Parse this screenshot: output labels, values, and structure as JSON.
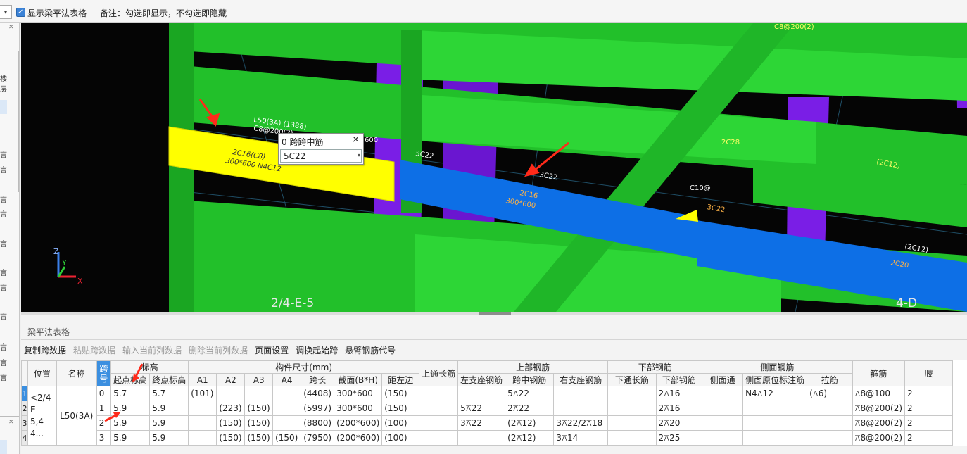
{
  "topbar": {
    "show_table_label": "显示梁平法表格",
    "remark": "备注：勾选即显示，不勾选即隐藏"
  },
  "viewport": {
    "popup": {
      "title": "0 跨跨中筋",
      "close": "×",
      "value": "5C22"
    },
    "axis_labels": {
      "left": "2/4-E-5",
      "right": "4-D"
    },
    "axis_gizmo": {
      "x": "X",
      "y": "Y",
      "z": "Z"
    },
    "annotations": {
      "beam_label_1": "L50(3A) (1388)",
      "beam_label_2": "C8@200(2)",
      "yellow_1": "2C16(C8)",
      "yellow_2": "300*600 N4C12",
      "popup_side": "600",
      "span_label": "5C22",
      "mid_1": "3C22",
      "mid_2": "2C16",
      "mid_3": "300*600",
      "mid_4": "3C22",
      "right_1": "2C28",
      "right_2": "(2C12)",
      "right_3": "(2C12)",
      "right_4": "2C20",
      "right_5": "C10@",
      "top_1": "C8@200(2)"
    },
    "colors": {
      "background": "#050505",
      "green_beam": "#22c02a",
      "selected_span": "#ffff00",
      "selected_beam": "#0d6fe6",
      "column": "#7a1ee6"
    }
  },
  "panel": {
    "title": "梁平法表格",
    "toolbar": [
      {
        "label": "复制跨数据",
        "enabled": true
      },
      {
        "label": "粘贴跨数据",
        "enabled": false
      },
      {
        "label": "输入当前列数据",
        "enabled": false
      },
      {
        "label": "删除当前列数据",
        "enabled": false
      },
      {
        "label": "页面设置",
        "enabled": true
      },
      {
        "label": "调换起始跨",
        "enabled": true
      },
      {
        "label": "悬臂钢筋代号",
        "enabled": true
      }
    ]
  },
  "table": {
    "group_headers": {
      "position": "位置",
      "name": "名称",
      "span_no": "跨号",
      "elevation": "标高",
      "dims": "构件尺寸(mm)",
      "top_through": "上通长筋",
      "top_rebar": "上部钢筋",
      "bottom_rebar": "下部钢筋",
      "side_rebar": "侧面钢筋",
      "stirrup": "箍筋",
      "limb": "肢"
    },
    "sub_headers": {
      "start_elev": "起点标高",
      "end_elev": "终点标高",
      "a1": "A1",
      "a2": "A2",
      "a3": "A3",
      "a4": "A4",
      "span_len": "跨长",
      "section": "截面(B*H)",
      "dist_left": "距左边",
      "left_support": "左支座钢筋",
      "mid_span": "跨中钢筋",
      "right_support": "右支座钢筋",
      "bottom_through": "下通长筋",
      "bottom": "下部钢筋",
      "side_through": "侧面通",
      "side_orig": "侧面原位标注筋",
      "tie": "拉筋"
    },
    "location": "<2/4-E-5,4-4...",
    "name": "L50(3A)",
    "rows": [
      {
        "num": "1",
        "span": "0",
        "start": "5.7",
        "end": "5.7",
        "a1": "(101)",
        "a2": "",
        "a3": "",
        "a4": "",
        "len": "(4408)",
        "section": "300*600",
        "dist": "(150)",
        "top_through": "",
        "left": "",
        "mid": "5⚻22",
        "right": "",
        "bthrough": "",
        "bottom": "2⚻16",
        "sthrough": "",
        "sorig": "N4⚻12",
        "tie": "(⚻6)",
        "stirrup": "⚻8@100",
        "limb": "2"
      },
      {
        "num": "2",
        "span": "1",
        "start": "5.9",
        "end": "5.9",
        "a1": "",
        "a2": "(223)",
        "a3": "(150)",
        "a4": "",
        "len": "(5997)",
        "section": "300*600",
        "dist": "(150)",
        "top_through": "",
        "left": "5⚻22",
        "mid": "2⚻22",
        "right": "",
        "bthrough": "",
        "bottom": "2⚻16",
        "sthrough": "",
        "sorig": "",
        "tie": "",
        "stirrup": "⚻8@200(2)",
        "limb": "2"
      },
      {
        "num": "3",
        "span": "2",
        "start": "5.9",
        "end": "5.9",
        "a1": "",
        "a2": "(150)",
        "a3": "(150)",
        "a4": "",
        "len": "(8800)",
        "section": "(200*600)",
        "dist": "(100)",
        "top_through": "",
        "left": "3⚻22",
        "mid": "(2⚻12)",
        "right": "3⚻22/2⚻18",
        "bthrough": "",
        "bottom": "2⚻20",
        "sthrough": "",
        "sorig": "",
        "tie": "",
        "stirrup": "⚻8@200(2)",
        "limb": "2"
      },
      {
        "num": "4",
        "span": "3",
        "start": "5.9",
        "end": "5.9",
        "a1": "",
        "a2": "(150)",
        "a3": "(150)",
        "a4": "(150)",
        "len": "(7950)",
        "section": "(200*600)",
        "dist": "(100)",
        "top_through": "",
        "left": "",
        "mid": "(2⚻12)",
        "right": "3⚻14",
        "bthrough": "",
        "bottom": "2⚻25",
        "sthrough": "",
        "sorig": "",
        "tie": "",
        "stirrup": "⚻8@200(2)",
        "limb": "2"
      }
    ]
  },
  "leftpanel": {
    "rows": [
      "楼层",
      "言",
      "言",
      "言",
      "言",
      "言",
      "言",
      "言",
      "言",
      "言",
      "言",
      "言"
    ]
  }
}
